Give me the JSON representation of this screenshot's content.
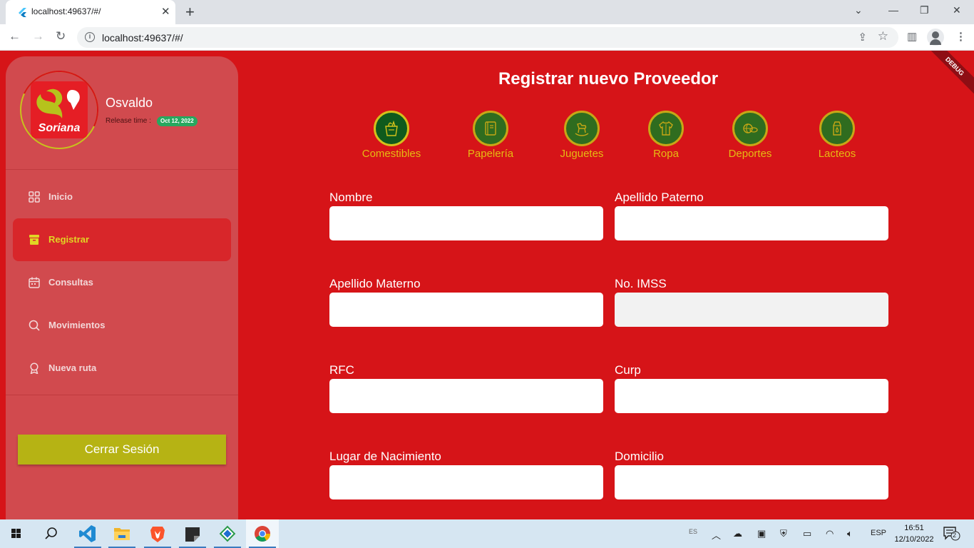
{
  "browser": {
    "tab_title": "localhost:49637/#/",
    "url": "localhost:49637/#/"
  },
  "app": {
    "debug_banner": "DEBUG",
    "title": "Registrar nuevo Proveedor",
    "brand": "Soriana",
    "user": {
      "name": "Osvaldo",
      "release_label": "Release time :",
      "release_date": "Oct 12, 2022"
    },
    "nav": [
      {
        "label": "Inicio",
        "icon": "grid-icon"
      },
      {
        "label": "Registrar",
        "icon": "archive-box-icon",
        "active": true
      },
      {
        "label": "Consultas",
        "icon": "calendar-icon"
      },
      {
        "label": "Movimientos",
        "icon": "search-icon"
      },
      {
        "label": "Nueva ruta",
        "icon": "award-icon"
      }
    ],
    "logout_label": "Cerrar Sesión",
    "categories": [
      {
        "label": "Comestibles",
        "icon": "grocery-bag-icon",
        "active": true
      },
      {
        "label": "Papelería",
        "icon": "notebook-icon"
      },
      {
        "label": "Juguetes",
        "icon": "rocking-horse-icon"
      },
      {
        "label": "Ropa",
        "icon": "shirt-icon"
      },
      {
        "label": "Deportes",
        "icon": "sports-balls-icon"
      },
      {
        "label": "Lacteos",
        "icon": "milk-carton-icon"
      }
    ],
    "form": {
      "nombre": {
        "label": "Nombre",
        "value": ""
      },
      "apellido_paterno": {
        "label": "Apellido Paterno",
        "value": ""
      },
      "apellido_materno": {
        "label": "Apellido Materno",
        "value": ""
      },
      "imss": {
        "label": "No. IMSS",
        "value": "",
        "disabled": true
      },
      "rfc": {
        "label": "RFC",
        "value": ""
      },
      "curp": {
        "label": "Curp",
        "value": ""
      },
      "lugar_nacimiento": {
        "label": "Lugar de Nacimiento",
        "value": ""
      },
      "domicilio": {
        "label": "Domicilio",
        "value": ""
      }
    }
  },
  "colors": {
    "background": "#d61418",
    "sidebar": "#d14a4e",
    "accent_yellow": "#e1d524",
    "logout_button": "#b6b314",
    "category_label": "#e6bb12",
    "category_circle": "#2f6c1f"
  },
  "taskbar": {
    "language": "ESP",
    "time": "16:51",
    "date": "12/10/2022",
    "notifications": "2",
    "ime": "ES"
  }
}
